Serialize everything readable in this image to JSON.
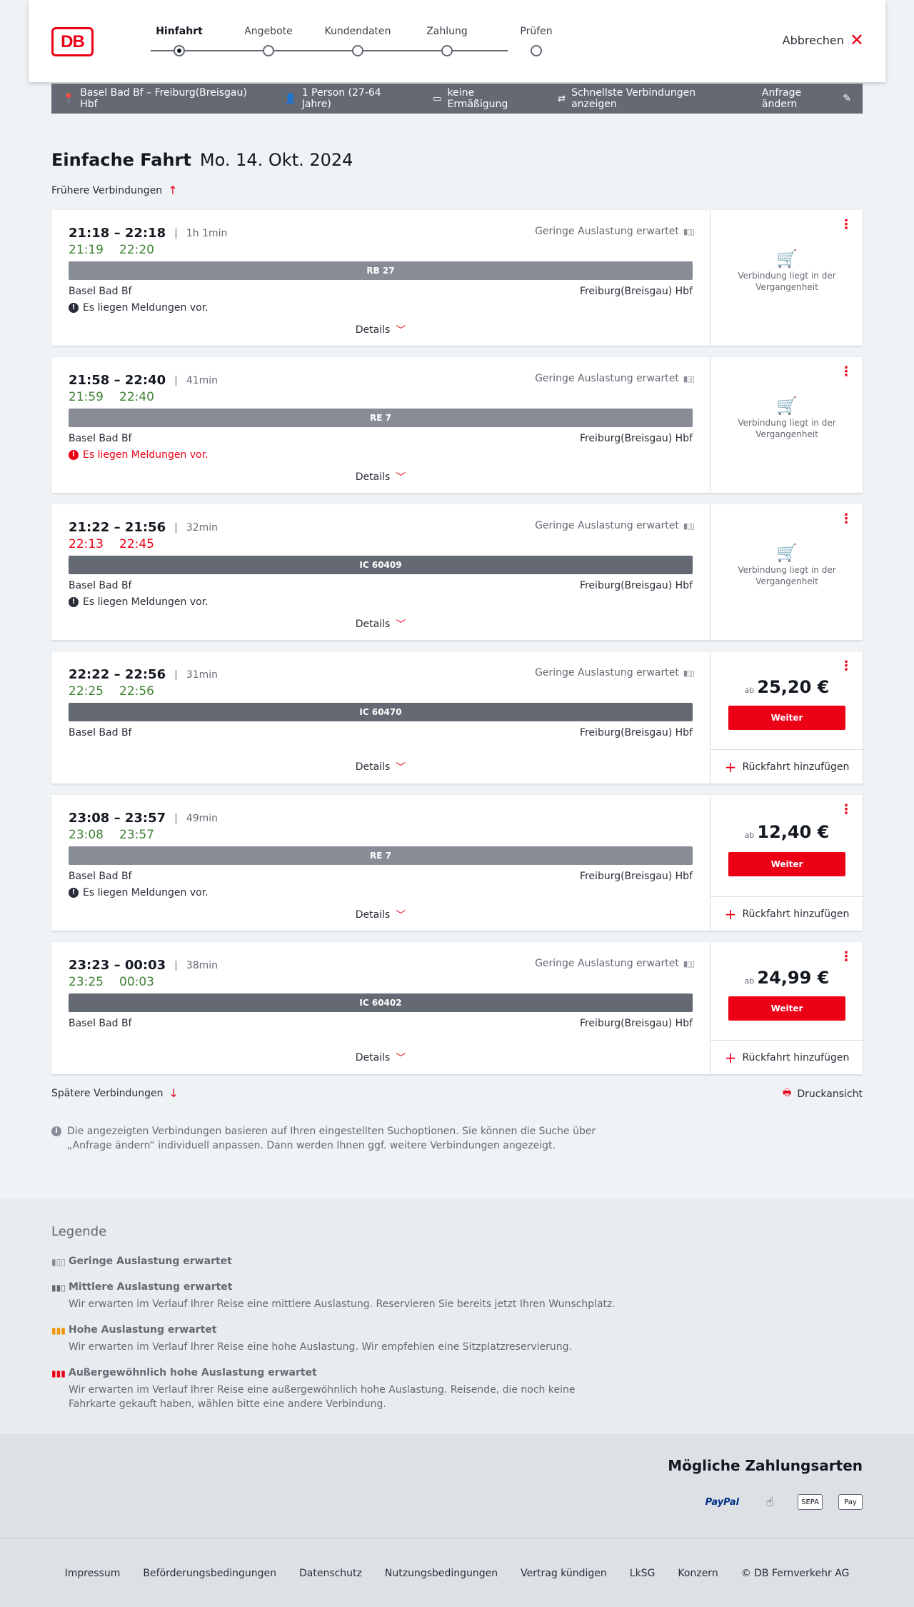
{
  "header": {
    "logo_text": "DB",
    "steps": [
      {
        "label": "Hinfahrt",
        "active": true
      },
      {
        "label": "Angebote",
        "active": false
      },
      {
        "label": "Kundendaten",
        "active": false
      },
      {
        "label": "Zahlung",
        "active": false
      },
      {
        "label": "Prüfen",
        "active": false
      }
    ],
    "cancel_label": "Abbrechen"
  },
  "filter": {
    "route": "Basel Bad Bf – Freiburg(Breisgau) Hbf",
    "passengers": "1 Person (27-64 Jahre)",
    "discount": "keine Ermäßigung",
    "fastest": "Schnellste Verbindungen anzeigen",
    "edit": "Anfrage ändern"
  },
  "title": {
    "trip_type": "Einfache Fahrt",
    "date": "Mo. 14. Okt. 2024"
  },
  "earlier": "Frühere Verbindungen",
  "later": "Spätere Verbindungen",
  "print": "Druckansicht",
  "connections": [
    {
      "times": "21:18 – 22:18",
      "duration": "1h 1min",
      "rt_dep": "21:19",
      "rt_arr": "22:20",
      "rt_color": "green",
      "occupancy": "Geringe Auslastung erwartet",
      "train": "RB 27",
      "train_style": "light",
      "from": "Basel Bad Bf",
      "to": "Freiburg(Breisgau) Hbf",
      "message": "Es liegen Meldungen vor.",
      "message_alert": false,
      "details": "Details",
      "past_text": "Verbindung liegt in der Vergangenheit"
    },
    {
      "times": "21:58 – 22:40",
      "duration": "41min",
      "rt_dep": "21:59",
      "rt_arr": "22:40",
      "rt_color": "green",
      "occupancy": "Geringe Auslastung erwartet",
      "train": "RE 7",
      "train_style": "light",
      "from": "Basel Bad Bf",
      "to": "Freiburg(Breisgau) Hbf",
      "message": "Es liegen Meldungen vor.",
      "message_alert": true,
      "details": "Details",
      "past_text": "Verbindung liegt in der Vergangenheit"
    },
    {
      "times": "21:22 – 21:56",
      "duration": "32min",
      "rt_dep": "22:13",
      "rt_arr": "22:45",
      "rt_color": "red",
      "occupancy": "Geringe Auslastung erwartet",
      "train": "IC 60409",
      "train_style": "dark",
      "from": "Basel Bad Bf",
      "to": "Freiburg(Breisgau) Hbf",
      "message": "Es liegen Meldungen vor.",
      "message_alert": false,
      "details": "Details",
      "past_text": "Verbindung liegt in der Vergangenheit"
    },
    {
      "times": "22:22 – 22:56",
      "duration": "31min",
      "rt_dep": "22:25",
      "rt_arr": "22:56",
      "rt_color": "green",
      "occupancy": "Geringe Auslastung erwartet",
      "train": "IC 60470",
      "train_style": "dark",
      "from": "Basel Bad Bf",
      "to": "Freiburg(Breisgau) Hbf",
      "message": "",
      "details": "Details",
      "price_prefix": "ab",
      "price": "25,20 €",
      "button": "Weiter",
      "return": "Rückfahrt hinzufügen"
    },
    {
      "times": "23:08 – 23:57",
      "duration": "49min",
      "rt_dep": "23:08",
      "rt_arr": "23:57",
      "rt_color": "green",
      "occupancy": "",
      "train": "RE 7",
      "train_style": "light",
      "from": "Basel Bad Bf",
      "to": "Freiburg(Breisgau) Hbf",
      "message": "Es liegen Meldungen vor.",
      "message_alert": false,
      "details": "Details",
      "price_prefix": "ab",
      "price": "12,40 €",
      "button": "Weiter",
      "return": "Rückfahrt hinzufügen"
    },
    {
      "times": "23:23 – 00:03",
      "duration": "38min",
      "rt_dep": "23:25",
      "rt_arr": "00:03",
      "rt_color": "green",
      "occupancy": "Geringe Auslastung erwartet",
      "train": "IC 60402",
      "train_style": "dark",
      "from": "Basel Bad Bf",
      "to": "Freiburg(Breisgau) Hbf",
      "message": "",
      "details": "Details",
      "price_prefix": "ab",
      "price": "24,99 €",
      "button": "Weiter",
      "return": "Rückfahrt hinzufügen"
    }
  ],
  "info_text": "Die angezeigten Verbindungen basieren auf Ihren eingestellten Suchoptionen. Sie können die Suche über „Anfrage ändern“ individuell anpassen. Dann werden Ihnen ggf. weitere Verbindungen angezeigt.",
  "legend": {
    "title": "Legende",
    "items": [
      {
        "title": "Geringe Auslastung erwartet",
        "desc": "",
        "color": "#878c96"
      },
      {
        "title": "Mittlere Auslastung erwartet",
        "desc": "Wir erwarten im Verlauf Ihrer Reise eine mittlere Auslastung. Reservieren Sie bereits jetzt Ihren Wunschplatz.",
        "color": "#646973"
      },
      {
        "title": "Hohe Auslastung erwartet",
        "desc": "Wir erwarten im Verlauf Ihrer Reise eine hohe Auslastung. Wir empfehlen eine Sitzplatzreservierung.",
        "color": "#f39200"
      },
      {
        "title": "Außergewöhnlich hohe Auslastung erwartet",
        "desc": "Wir erwarten im Verlauf Ihrer Reise eine außergewöhnlich hohe Auslastung. Reisende, die noch keine Fahrkarte gekauft haben, wählen bitte eine andere Verbindung.",
        "color": "#ec0016"
      }
    ]
  },
  "payment": {
    "title": "Mögliche Zahlungsarten",
    "paypal": "PayPal",
    "sepa": "SEPA",
    "applepay": "Pay"
  },
  "footer": [
    "Impressum",
    "Beförderungsbedingungen",
    "Datenschutz",
    "Nutzungsbedingungen",
    "Vertrag kündigen",
    "LkSG",
    "Konzern",
    "© DB Fernverkehr AG"
  ]
}
